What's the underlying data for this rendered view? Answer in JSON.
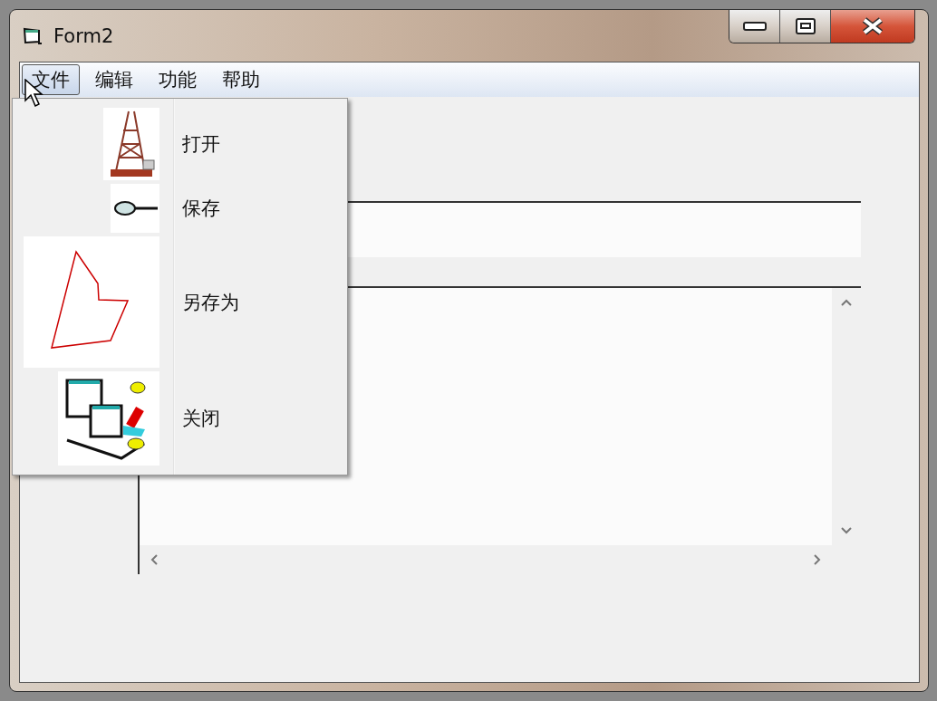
{
  "window": {
    "title": "Form2"
  },
  "menu_bar": [
    {
      "label": "文件",
      "selected": true
    },
    {
      "label": "编辑",
      "selected": false
    },
    {
      "label": "功能",
      "selected": false
    },
    {
      "label": "帮助",
      "selected": false
    }
  ],
  "dropdown": [
    {
      "label": "打开",
      "kind": "tower"
    },
    {
      "label": "保存",
      "kind": "magnifier"
    },
    {
      "label": "另存为",
      "kind": "polygon"
    },
    {
      "label": "关闭",
      "kind": "folders"
    }
  ]
}
